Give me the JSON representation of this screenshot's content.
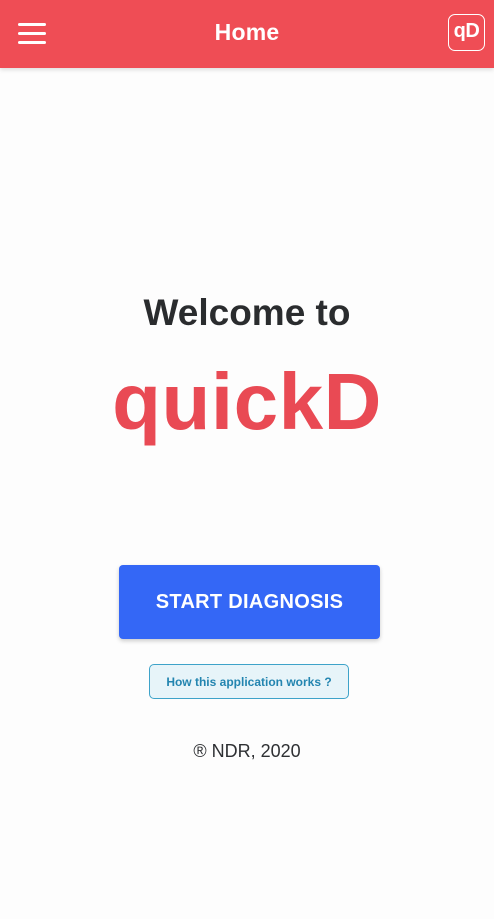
{
  "appbar": {
    "title": "Home",
    "menu_icon": "hamburger-menu-icon",
    "logo_text": "qD",
    "background_color": "#ef4d55"
  },
  "main": {
    "welcome_text": "Welcome to",
    "app_name": "quickD",
    "start_button_label": "START DIAGNOSIS",
    "how_it_works_label": "How this application works ?",
    "copyright": "® NDR, 2020"
  },
  "colors": {
    "brand_red": "#e94a54",
    "primary_blue": "#3467f6",
    "info_border": "#3ea3c9",
    "info_bg": "#e7f4f9"
  }
}
